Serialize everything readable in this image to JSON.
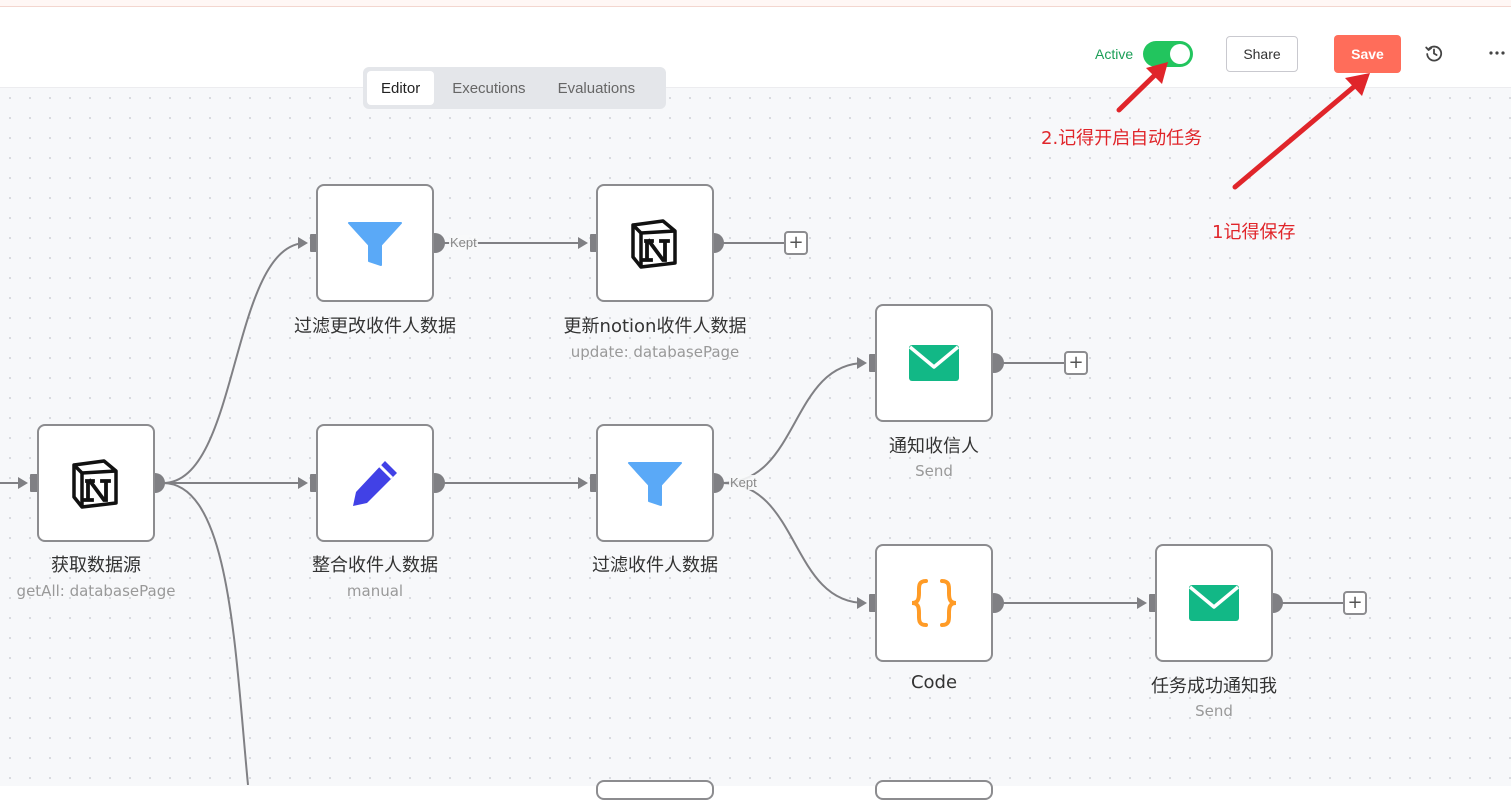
{
  "header": {
    "active_label": "Active",
    "active_on": true,
    "share_label": "Share",
    "save_label": "Save",
    "accent_color": "#ff6d5a",
    "active_color": "#22c55e"
  },
  "tabs": [
    {
      "label": "Editor",
      "active": true
    },
    {
      "label": "Executions",
      "active": false
    },
    {
      "label": "Evaluations",
      "active": false
    }
  ],
  "nodes": {
    "get_data": {
      "title": "获取数据源",
      "subtitle": "getAll: databasePage",
      "icon": "notion-icon"
    },
    "filter_change": {
      "title": "过滤更改收件人数据",
      "subtitle": "",
      "icon": "filter-icon"
    },
    "update_notion": {
      "title": "更新notion收件人数据",
      "subtitle": "update: databasePage",
      "icon": "notion-icon"
    },
    "merge_recipients": {
      "title": "整合收件人数据",
      "subtitle": "manual",
      "icon": "pencil-icon"
    },
    "filter_recipients": {
      "title": "过滤收件人数据",
      "subtitle": "",
      "icon": "filter-icon"
    },
    "notify_recipient": {
      "title": "通知收信人",
      "subtitle": "Send",
      "icon": "mail-icon"
    },
    "code": {
      "title": "Code",
      "subtitle": "",
      "icon": "code-braces-icon"
    },
    "notify_me": {
      "title": "任务成功通知我",
      "subtitle": "Send",
      "icon": "mail-icon"
    }
  },
  "edge_labels": {
    "kept_1": "Kept",
    "kept_2": "Kept"
  },
  "annotations": {
    "note_active": "2.记得开启自动任务",
    "note_save": "1记得保存",
    "color": "#e0252a"
  }
}
